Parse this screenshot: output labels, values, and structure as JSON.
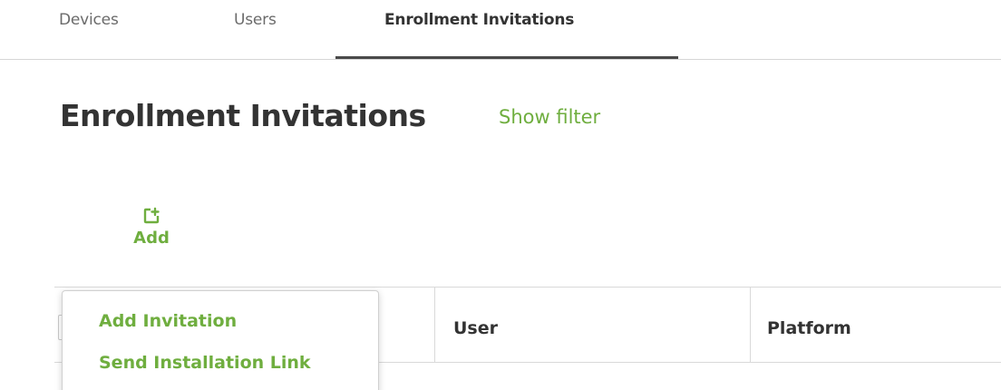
{
  "tabs": [
    {
      "label": "Devices"
    },
    {
      "label": "Users"
    },
    {
      "label": "Enrollment Invitations",
      "active": true
    }
  ],
  "page": {
    "title": "Enrollment Invitations",
    "show_filter": "Show filter"
  },
  "toolbar": {
    "add_label": "Add",
    "add_icon": "add-document-icon"
  },
  "table": {
    "columns": [
      "",
      "User",
      "Platform"
    ]
  },
  "add_menu": {
    "items": [
      "Add Invitation",
      "Send Installation Link"
    ]
  },
  "colors": {
    "accent": "#6fae3f",
    "text": "#333333",
    "tab_inactive": "#6b6b6b"
  }
}
